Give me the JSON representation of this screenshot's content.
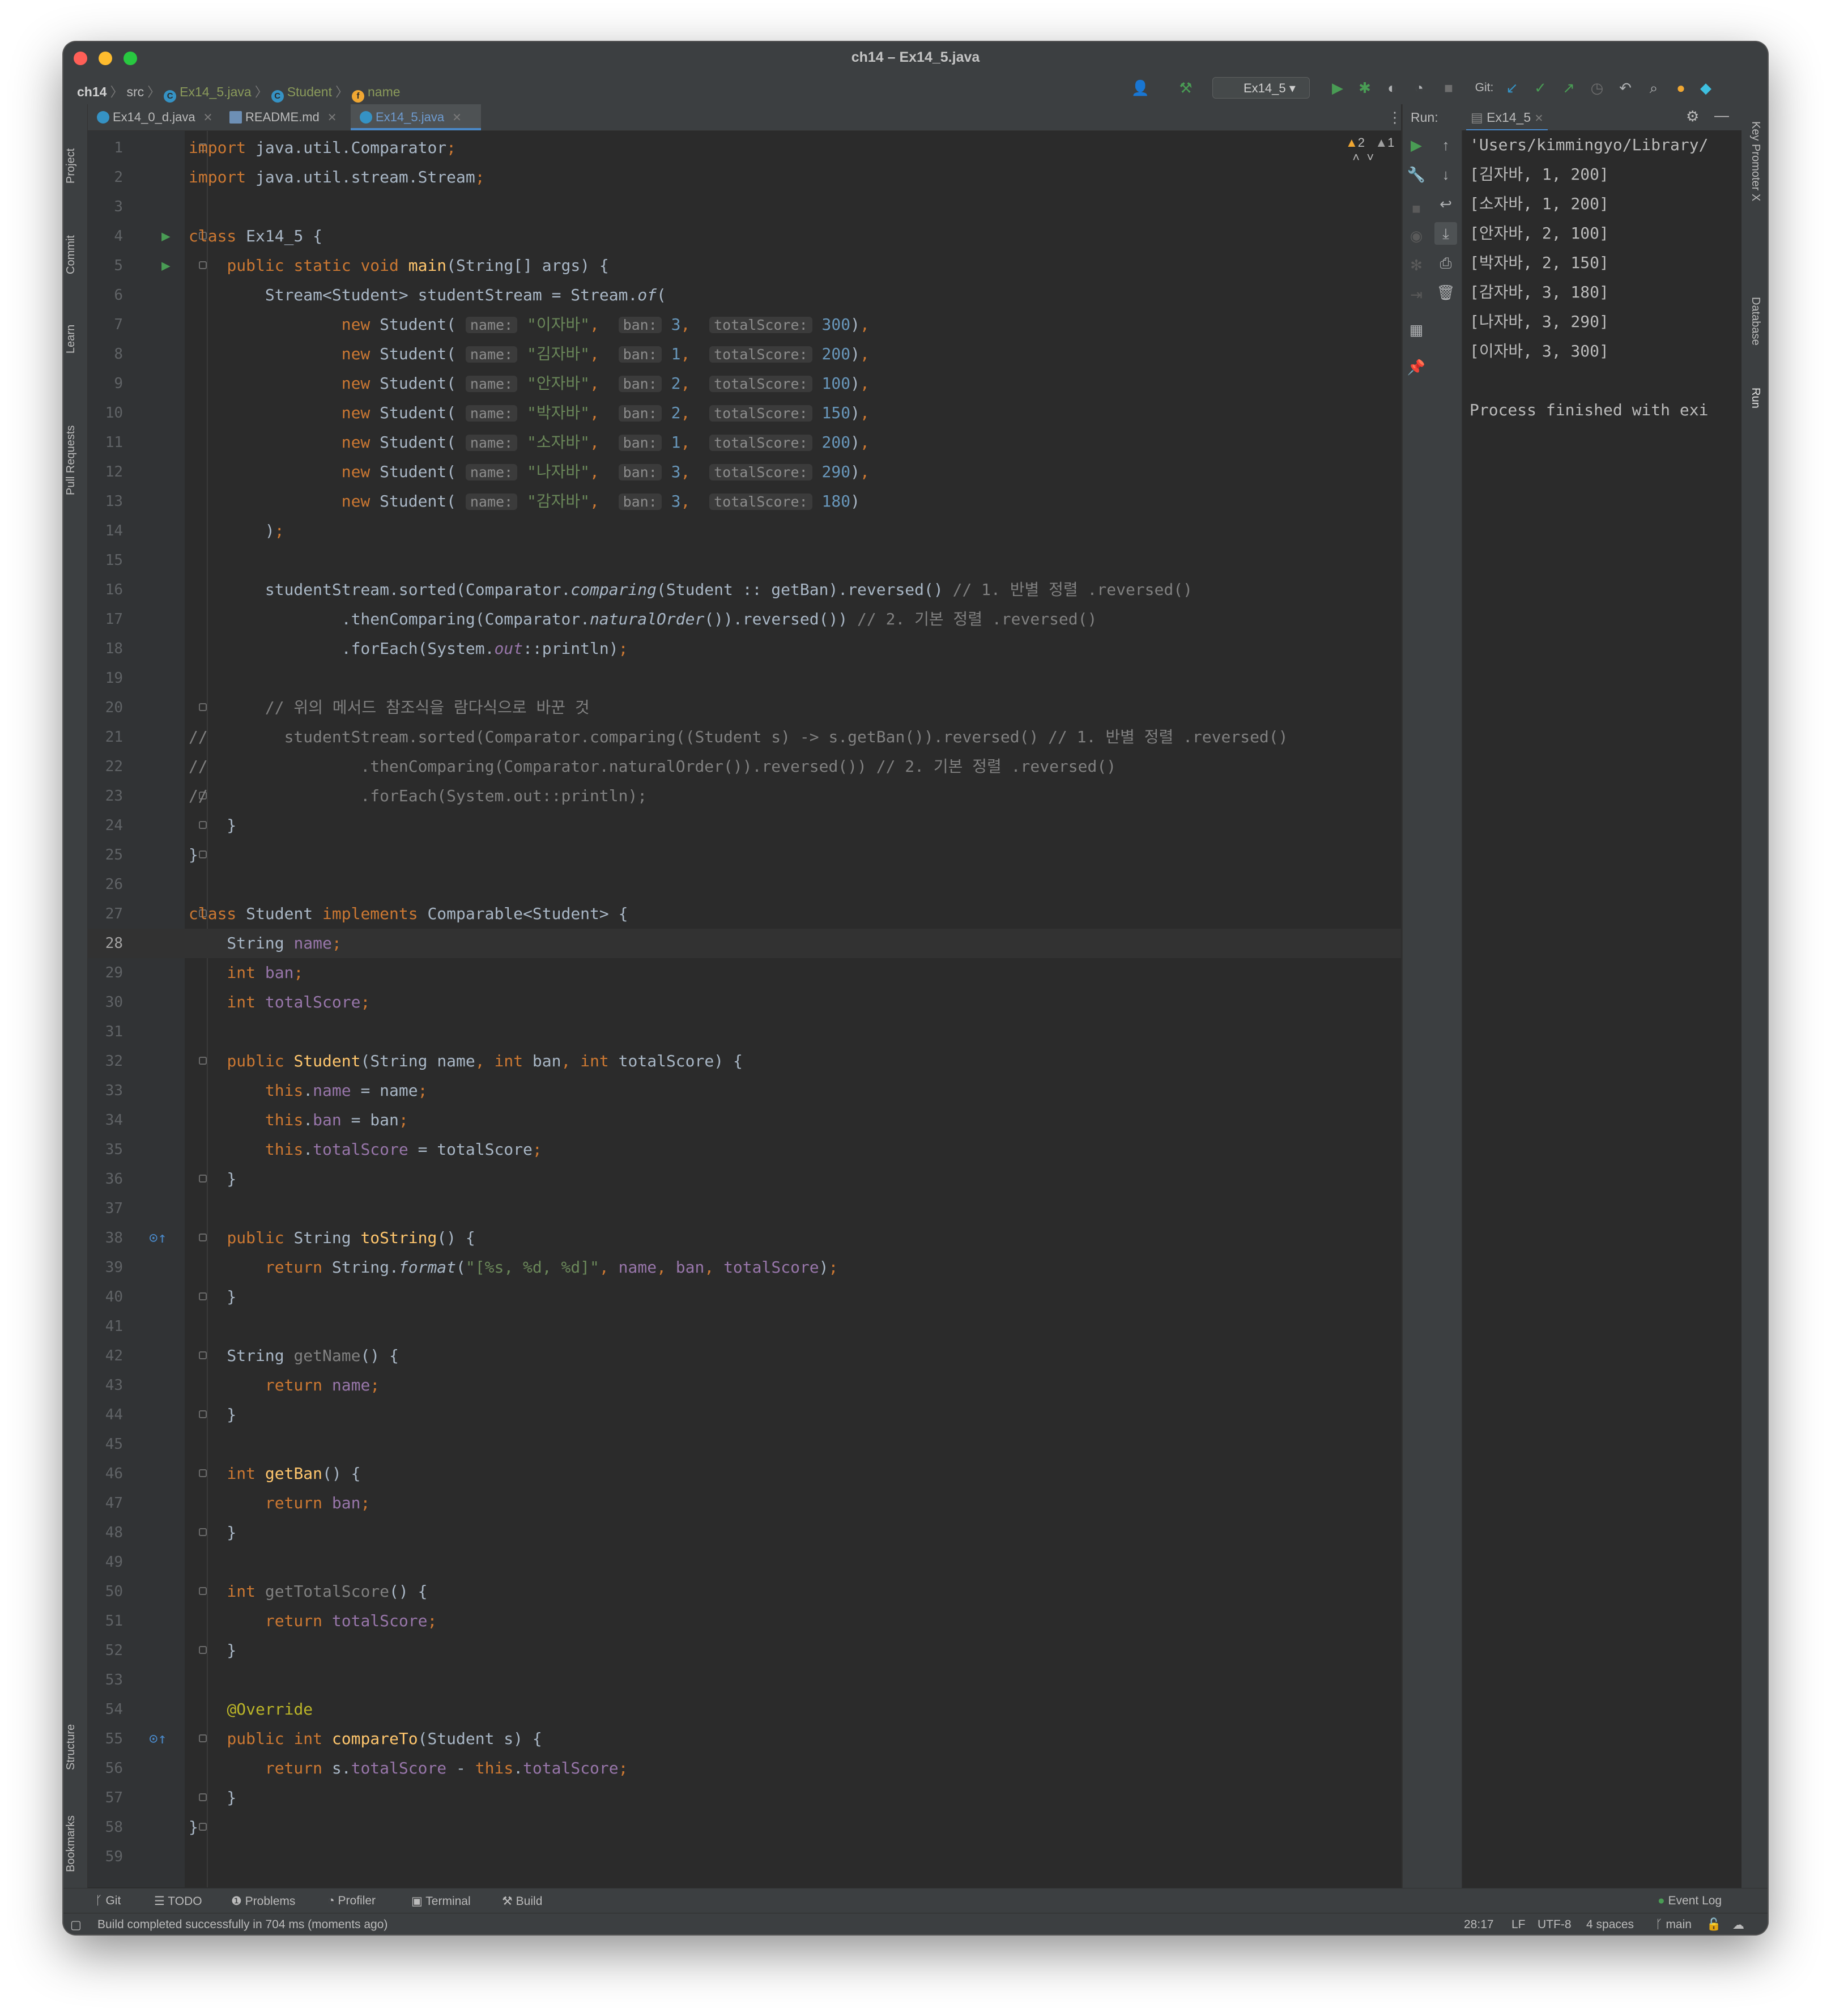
{
  "window": {
    "title": "ch14 – Ex14_5.java"
  },
  "breadcrumb": {
    "project": "ch14",
    "folder": "src",
    "file": "Ex14_5.java",
    "class": "Student",
    "field": "name"
  },
  "toolbar": {
    "run_config": "Ex14_5",
    "git_label": "Git:"
  },
  "left_tools": [
    "Project",
    "Commit",
    "Learn",
    "Pull Requests",
    "Structure",
    "Bookmarks"
  ],
  "right_tools": [
    "Key Promoter X",
    "Database",
    "Run"
  ],
  "tabs": [
    {
      "label": "Ex14_0_d.java",
      "active": false
    },
    {
      "label": "README.md",
      "active": false
    },
    {
      "label": "Ex14_5.java",
      "active": true
    }
  ],
  "inspections": {
    "warnings": "2",
    "weak_warnings": "1"
  },
  "editor": {
    "current_line": 28,
    "line_numbers": [
      "1",
      "2",
      "3",
      "4",
      "5",
      "6",
      "7",
      "8",
      "9",
      "10",
      "11",
      "12",
      "13",
      "14",
      "15",
      "16",
      "17",
      "18",
      "19",
      "20",
      "21",
      "22",
      "23",
      "24",
      "25",
      "26",
      "27",
      "28",
      "29",
      "30",
      "31",
      "32",
      "33",
      "34",
      "35",
      "36",
      "37",
      "38",
      "39",
      "40",
      "41",
      "42",
      "43",
      "44",
      "45",
      "46",
      "47",
      "48",
      "49",
      "50",
      "51",
      "52",
      "53",
      "54",
      "55",
      "56",
      "57",
      "58",
      "59"
    ]
  },
  "run_panel": {
    "label": "Run:",
    "tab": "Ex14_5",
    "output": [
      "'Users/kimmingyo/Library/",
      "[김자바, 1, 200]",
      "[소자바, 1, 200]",
      "[안자바, 2, 100]",
      "[박자바, 2, 150]",
      "[감자바, 3, 180]",
      "[나자바, 3, 290]",
      "[이자바, 3, 300]",
      "",
      "Process finished with exi"
    ]
  },
  "tool_windows": [
    "Git",
    "TODO",
    "Problems",
    "Profiler",
    "Terminal",
    "Build"
  ],
  "event_log": "Event Log",
  "status": {
    "message": "Build completed successfully in 704 ms (moments ago)",
    "position": "28:17",
    "line_sep": "LF",
    "encoding": "UTF-8",
    "indent": "4 spaces",
    "branch": "main"
  },
  "colors": {
    "keyword": "#cc7832",
    "string": "#6a8759",
    "number": "#6897bb",
    "field": "#9876aa",
    "method": "#ffc66d",
    "comment": "#808080",
    "background": "#2b2b2b"
  }
}
